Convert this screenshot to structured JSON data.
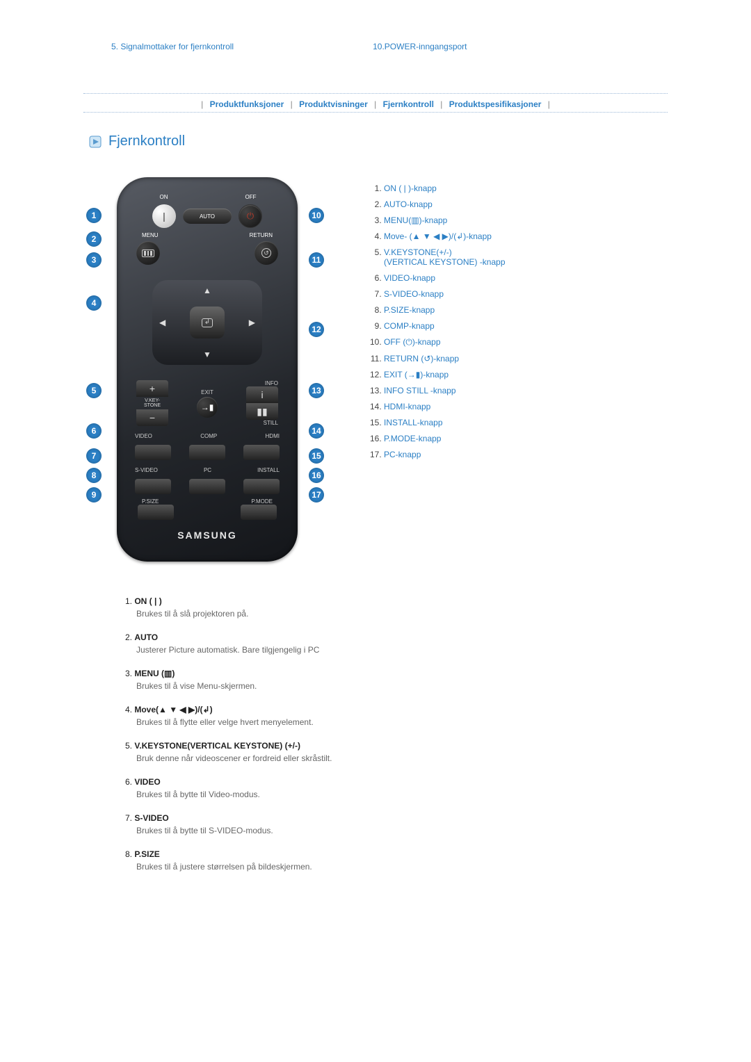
{
  "top": {
    "left": "5. Signalmottaker for fjernkontroll",
    "right": "10.POWER-inngangsport"
  },
  "breadcrumb": {
    "items": [
      "Produktfunksjoner",
      "Produktvisninger",
      "Fjernkontroll",
      "Produktspesifikasjoner"
    ]
  },
  "section_title": "Fjernkontroll",
  "remote": {
    "on_label": "ON",
    "off_label": "OFF",
    "auto": "AUTO",
    "menu": "MENU",
    "return": "RETURN",
    "vkey": "V.KEY-\nSTONE",
    "exit": "EXIT",
    "info": "INFO",
    "still": "STILL",
    "video": "VIDEO",
    "comp": "COMP",
    "hdmi": "HDMI",
    "svideo": "S-VIDEO",
    "pc": "PC",
    "install": "INSTALL",
    "psize": "P.SIZE",
    "pmode": "P.MODE",
    "brand": "SAMSUNG"
  },
  "callouts": {
    "1": "1",
    "2": "2",
    "3": "3",
    "4": "4",
    "5": "5",
    "6": "6",
    "7": "7",
    "8": "8",
    "9": "9",
    "10": "10",
    "11": "11",
    "12": "12",
    "13": "13",
    "14": "14",
    "15": "15",
    "16": "16",
    "17": "17"
  },
  "link_list": [
    {
      "text": "ON ( | )-knapp"
    },
    {
      "text": "AUTO-knapp"
    },
    {
      "text": "MENU(▥)-knapp"
    },
    {
      "text": "Move- (▲ ▼ ◀ ▶)/(↲)-knapp"
    },
    {
      "text": "V.KEYSTONE(+/-)\n(VERTICAL KEYSTONE) -knapp"
    },
    {
      "text": "VIDEO-knapp"
    },
    {
      "text": "S-VIDEO-knapp"
    },
    {
      "text": "P.SIZE-knapp"
    },
    {
      "text": "COMP-knapp"
    },
    {
      "text": "OFF (⏻)-knapp"
    },
    {
      "text": "RETURN (↺)-knapp"
    },
    {
      "text": "EXIT (→▮)-knapp"
    },
    {
      "text": "INFO STILL -knapp"
    },
    {
      "text": "HDMI-knapp"
    },
    {
      "text": "INSTALL-knapp"
    },
    {
      "text": "P.MODE-knapp"
    },
    {
      "text": "PC-knapp"
    }
  ],
  "descriptions": [
    {
      "num": "1.",
      "title": "ON ( | )",
      "body": "Brukes til å slå projektoren på."
    },
    {
      "num": "2.",
      "title": "AUTO",
      "body": "Justerer Picture automatisk. Bare tilgjengelig i PC"
    },
    {
      "num": "3.",
      "title": "MENU (▥)",
      "body": "Brukes til å vise Menu-skjermen."
    },
    {
      "num": "4.",
      "title": "Move(▲ ▼ ◀ ▶)/(↲)",
      "body": "Brukes til å flytte eller velge hvert menyelement."
    },
    {
      "num": "5.",
      "title": "V.KEYSTONE(VERTICAL KEYSTONE) (+/-)",
      "body": "Bruk denne når videoscener er fordreid eller skråstilt."
    },
    {
      "num": "6.",
      "title": "VIDEO",
      "body": "Brukes til å bytte til Video-modus."
    },
    {
      "num": "7.",
      "title": "S-VIDEO",
      "body": "Brukes til å bytte til S-VIDEO-modus."
    },
    {
      "num": "8.",
      "title": "P.SIZE",
      "body": "Brukes til å justere størrelsen på bildeskjermen."
    }
  ]
}
